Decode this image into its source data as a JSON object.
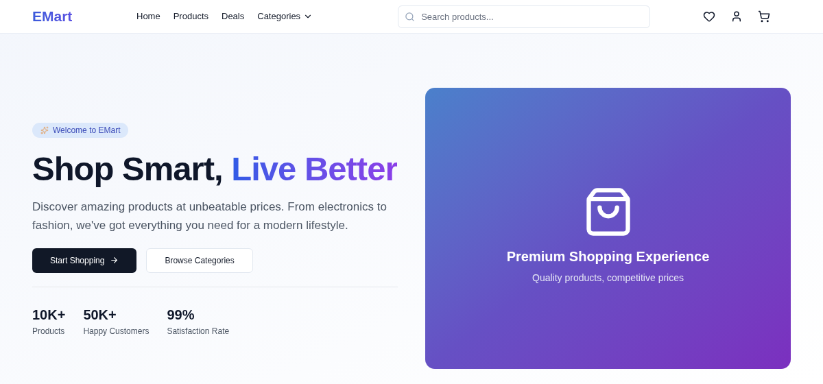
{
  "header": {
    "logo": "EMart",
    "nav": [
      {
        "label": "Home",
        "dropdown": false
      },
      {
        "label": "Products",
        "dropdown": false
      },
      {
        "label": "Deals",
        "dropdown": false
      },
      {
        "label": "Categories",
        "dropdown": true
      }
    ],
    "search": {
      "placeholder": "Search products..."
    }
  },
  "hero": {
    "badge": "Welcome to EMart",
    "heading": "Shop Smart,",
    "heading_highlight": "Live Better",
    "description": "Discover amazing products at unbeatable prices. From electronics to fashion, we've got everything you need for a modern lifestyle.",
    "buttons": [
      {
        "label": "Start Shopping",
        "kind": "primary"
      },
      {
        "label": "Browse Categories",
        "kind": "secondary"
      }
    ],
    "stats": [
      {
        "value": "10K+",
        "label": "Products"
      },
      {
        "value": "50K+",
        "label": "Happy Customers"
      },
      {
        "value": "99%",
        "label": "Satisfaction Rate"
      }
    ]
  },
  "feature_card": {
    "title": "Premium Shopping Experience",
    "subtitle": "Quality products, competitive prices"
  }
}
